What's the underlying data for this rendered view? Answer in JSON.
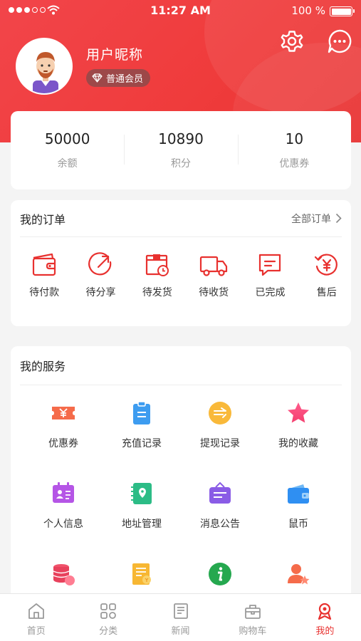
{
  "status_bar": {
    "time": "11:27 AM",
    "battery": "100 %"
  },
  "profile": {
    "nickname": "用户昵称",
    "member_level": "普通会员"
  },
  "stats": [
    {
      "value": "50000",
      "label": "余额"
    },
    {
      "value": "10890",
      "label": "积分"
    },
    {
      "value": "10",
      "label": "优惠券"
    }
  ],
  "orders": {
    "title": "我的订单",
    "all_link": "全部订单",
    "items": [
      {
        "label": "待付款",
        "icon": "wallet-icon"
      },
      {
        "label": "待分享",
        "icon": "share-icon"
      },
      {
        "label": "待发货",
        "icon": "package-clock-icon"
      },
      {
        "label": "待收货",
        "icon": "truck-icon"
      },
      {
        "label": "已完成",
        "icon": "message-check-icon"
      },
      {
        "label": "售后",
        "icon": "refund-icon"
      }
    ]
  },
  "services": {
    "title": "我的服务",
    "items": [
      {
        "label": "优惠券",
        "icon": "coupon-icon"
      },
      {
        "label": "充值记录",
        "icon": "clipboard-icon"
      },
      {
        "label": "提现记录",
        "icon": "withdraw-icon"
      },
      {
        "label": "我的收藏",
        "icon": "star-icon"
      },
      {
        "label": "个人信息",
        "icon": "id-card-icon"
      },
      {
        "label": "地址管理",
        "icon": "location-book-icon"
      },
      {
        "label": "消息公告",
        "icon": "announcement-icon"
      },
      {
        "label": "鼠币",
        "icon": "wallet-blue-icon"
      },
      {
        "label": "",
        "icon": "coins-icon"
      },
      {
        "label": "",
        "icon": "bill-icon"
      },
      {
        "label": "",
        "icon": "info-icon"
      },
      {
        "label": "",
        "icon": "user-star-icon"
      }
    ]
  },
  "tabbar": [
    {
      "label": "首页",
      "icon": "home-icon"
    },
    {
      "label": "分类",
      "icon": "category-icon"
    },
    {
      "label": "新闻",
      "icon": "news-icon"
    },
    {
      "label": "购物车",
      "icon": "cart-icon"
    },
    {
      "label": "我的",
      "icon": "profile-icon",
      "active": true
    }
  ],
  "colors": {
    "brand_red": "#ef3b3b",
    "active_tab": "#e8312f"
  }
}
